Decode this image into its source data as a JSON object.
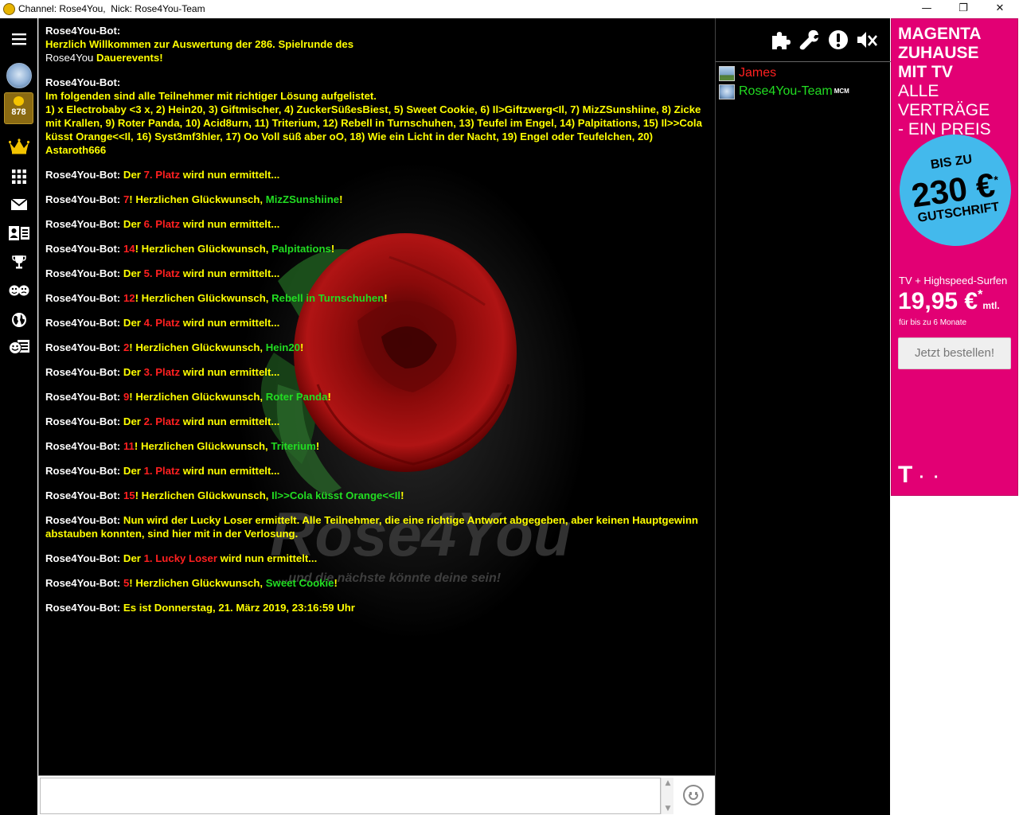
{
  "window": {
    "title": "Channel: Rose4You,  Nick: Rose4You-Team",
    "controls": {
      "minimize": "—",
      "restore": "❐",
      "close": "✕"
    }
  },
  "sidebar": {
    "points": "878",
    "icons": [
      "menu-icon",
      "avatar",
      "points-badge",
      "crown-icon",
      "apps-grid-icon",
      "mail-icon",
      "contacts-icon",
      "trophy-icon",
      "games-icon",
      "globe-icon",
      "smiley-news-icon"
    ]
  },
  "chat": {
    "messages": [
      {
        "nick": "Rose4You-Bot:",
        "parts": [
          {
            "t": "Herzlich Willkommen zur Auswertung der  286. Spielrunde des ",
            "c": "y",
            "block": true
          },
          {
            "t": "Rose4You",
            "c": "w"
          },
          {
            "t": " Dauerevents!",
            "c": "y"
          }
        ]
      },
      {
        "nick": "Rose4You-Bot:",
        "parts": [
          {
            "t": "Im folgenden sind alle Teilnehmer mit richtiger Lösung aufgelistet.",
            "c": "y",
            "block": true
          },
          {
            "t": "1) x Electrobaby <3 x, 2) Hein20, 3) Giftmischer, 4) ZuckerSüßesBiest, 5) Sweet Cookie, 6) Il>Giftzwerg<Il, 7) MizZSunshiine, 8) Zicke mit Krallen, 9) Roter Panda, 10) Acid8urn, 11) Triterium, 12) Rebell in Turnschuhen, 13) Teufel im Engel, 14) Palpitations, 15) Il>>Cola küsst Orange<<Il, 16) Syst3mf3hler, 17) Oo Voll süß aber oO, 18) Wie ein Licht in der Nacht, 19) Engel oder Teufelchen, 20) Astaroth666",
            "c": "y",
            "block": true
          }
        ]
      },
      {
        "nick": "Rose4You-Bot:",
        "parts": [
          {
            "t": " Der ",
            "c": "y"
          },
          {
            "t": "7. Platz",
            "c": "r"
          },
          {
            "t": " wird nun ermittelt...",
            "c": "y"
          }
        ]
      },
      {
        "nick": "Rose4You-Bot:",
        "parts": [
          {
            "t": " ",
            "c": "y"
          },
          {
            "t": "7",
            "c": "r"
          },
          {
            "t": "! Herzlichen Glückwunsch, ",
            "c": "y"
          },
          {
            "t": "MizZSunshiine",
            "c": "g"
          },
          {
            "t": "!",
            "c": "y"
          }
        ]
      },
      {
        "nick": "Rose4You-Bot:",
        "parts": [
          {
            "t": " Der ",
            "c": "y"
          },
          {
            "t": "6. Platz",
            "c": "r"
          },
          {
            "t": " wird nun ermittelt...",
            "c": "y"
          }
        ]
      },
      {
        "nick": "Rose4You-Bot:",
        "parts": [
          {
            "t": " ",
            "c": "y"
          },
          {
            "t": "14",
            "c": "r"
          },
          {
            "t": "! Herzlichen Glückwunsch, ",
            "c": "y"
          },
          {
            "t": "Palpitations",
            "c": "g"
          },
          {
            "t": "!",
            "c": "y"
          }
        ]
      },
      {
        "nick": "Rose4You-Bot:",
        "parts": [
          {
            "t": " Der ",
            "c": "y"
          },
          {
            "t": "5. Platz",
            "c": "r"
          },
          {
            "t": " wird nun ermittelt...",
            "c": "y"
          }
        ]
      },
      {
        "nick": "Rose4You-Bot:",
        "parts": [
          {
            "t": " ",
            "c": "y"
          },
          {
            "t": "12",
            "c": "r"
          },
          {
            "t": "! Herzlichen Glückwunsch, ",
            "c": "y"
          },
          {
            "t": "Rebell in Turnschuhen",
            "c": "g"
          },
          {
            "t": "!",
            "c": "y"
          }
        ]
      },
      {
        "nick": "Rose4You-Bot:",
        "parts": [
          {
            "t": " Der ",
            "c": "y"
          },
          {
            "t": "4. Platz",
            "c": "r"
          },
          {
            "t": " wird nun ermittelt...",
            "c": "y"
          }
        ]
      },
      {
        "nick": "Rose4You-Bot:",
        "parts": [
          {
            "t": " ",
            "c": "y"
          },
          {
            "t": "2",
            "c": "r"
          },
          {
            "t": "! Herzlichen Glückwunsch, ",
            "c": "y"
          },
          {
            "t": "Hein20",
            "c": "g"
          },
          {
            "t": "!",
            "c": "y"
          }
        ]
      },
      {
        "nick": "Rose4You-Bot:",
        "parts": [
          {
            "t": " Der ",
            "c": "y"
          },
          {
            "t": "3. Platz",
            "c": "r"
          },
          {
            "t": " wird nun ermittelt...",
            "c": "y"
          }
        ]
      },
      {
        "nick": "Rose4You-Bot:",
        "parts": [
          {
            "t": " ",
            "c": "y"
          },
          {
            "t": "9",
            "c": "r"
          },
          {
            "t": "! Herzlichen Glückwunsch, ",
            "c": "y"
          },
          {
            "t": "Roter Panda",
            "c": "g"
          },
          {
            "t": "!",
            "c": "y"
          }
        ]
      },
      {
        "nick": "Rose4You-Bot:",
        "parts": [
          {
            "t": " Der ",
            "c": "y"
          },
          {
            "t": "2. Platz",
            "c": "r"
          },
          {
            "t": " wird nun ermittelt...",
            "c": "y"
          }
        ]
      },
      {
        "nick": "Rose4You-Bot:",
        "parts": [
          {
            "t": " ",
            "c": "y"
          },
          {
            "t": "11",
            "c": "r"
          },
          {
            "t": "! Herzlichen Glückwunsch, ",
            "c": "y"
          },
          {
            "t": "Triterium",
            "c": "g"
          },
          {
            "t": "!",
            "c": "y"
          }
        ]
      },
      {
        "nick": "Rose4You-Bot:",
        "parts": [
          {
            "t": " Der ",
            "c": "y"
          },
          {
            "t": "1. Platz",
            "c": "r"
          },
          {
            "t": " wird nun ermittelt...",
            "c": "y"
          }
        ]
      },
      {
        "nick": "Rose4You-Bot:",
        "parts": [
          {
            "t": " ",
            "c": "y"
          },
          {
            "t": "15",
            "c": "r"
          },
          {
            "t": "! Herzlichen Glückwunsch, ",
            "c": "y"
          },
          {
            "t": "Il>>Cola küsst Orange<<Il",
            "c": "g"
          },
          {
            "t": "!",
            "c": "y"
          }
        ]
      },
      {
        "nick": "Rose4You-Bot:",
        "parts": [
          {
            "t": " Nun wird der Lucky Loser ermittelt. Alle Teilnehmer, die eine richtige Antwort abgegeben, aber keinen Hauptgewinn abstauben konnten, sind hier mit in der Verlosung.",
            "c": "y"
          }
        ]
      },
      {
        "nick": "Rose4You-Bot:",
        "parts": [
          {
            "t": " Der ",
            "c": "y"
          },
          {
            "t": "1. Lucky Loser",
            "c": "r"
          },
          {
            "t": " wird nun ermittelt...",
            "c": "y"
          }
        ]
      },
      {
        "nick": "Rose4You-Bot:",
        "parts": [
          {
            "t": " ",
            "c": "y"
          },
          {
            "t": "5",
            "c": "r"
          },
          {
            "t": "! Herzlichen Glückwunsch, ",
            "c": "y"
          },
          {
            "t": "Sweet Cookie",
            "c": "g"
          },
          {
            "t": "!",
            "c": "y"
          }
        ]
      },
      {
        "nick": "Rose4You-Bot:",
        "parts": [
          {
            "t": " Es ist Donnerstag, 21. März 2019, 23:16:59 Uhr",
            "c": "y"
          }
        ]
      }
    ],
    "background_logo": "Rose4You",
    "background_slogan": "...und die nächste könnte deine sein!"
  },
  "input": {
    "value": ""
  },
  "toolbar": {
    "icons": [
      "puzzle-icon",
      "wrench-icon",
      "alert-icon",
      "mute-icon"
    ]
  },
  "users": [
    {
      "name": "James",
      "color": "#ff2020",
      "badge": ""
    },
    {
      "name": "Rose4You-Team",
      "color": "#22dd22",
      "badge": "MCM"
    }
  ],
  "ad": {
    "headline": [
      "MAGENTA",
      "ZUHAUSE",
      "MIT TV"
    ],
    "subheadline": [
      "ALLE VERTRÄGE",
      "- EIN PREIS"
    ],
    "circle_top": "BIS ZU",
    "circle_amount": "230 €",
    "circle_star": "*",
    "circle_bottom": "GUTSCHRIFT",
    "offer": "TV + Highspeed-Surfen",
    "price": "19,95 €",
    "price_star": "*",
    "price_unit": "mtl.",
    "duration": "für bis zu 6 Monate",
    "cta": "Jetzt bestellen!",
    "logo": "T",
    "logo_dots": "· ·",
    "color": "#e20074"
  }
}
